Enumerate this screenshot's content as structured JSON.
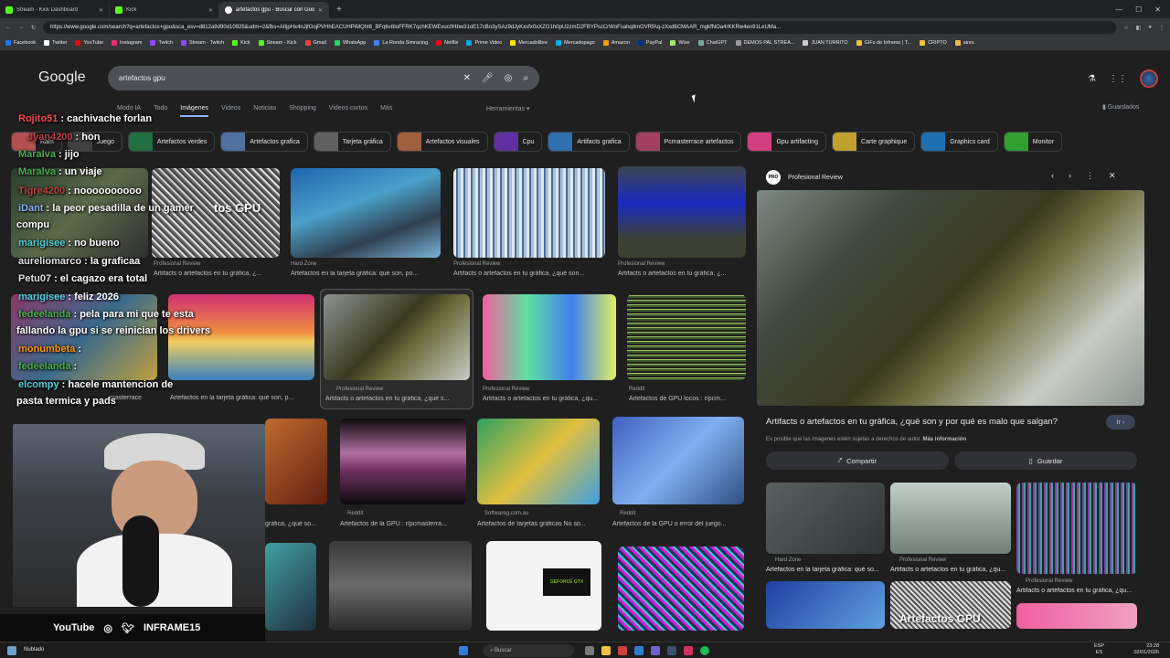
{
  "tabs": [
    {
      "title": "Stream - Kick Dashboard",
      "active": false
    },
    {
      "title": "Kick",
      "active": false
    },
    {
      "title": "artefactos gpu - Buscar con Google",
      "active": true
    }
  ],
  "address": {
    "url": "https://www.google.com/search?q=artefactos+gpu&sca_esv=d812a9d90d10925&udm=2&fbs=AIIjpHx4nJjfGojPVHhEACUHPiMQht6_BFq6v8IoFFRK7qchKEWEvuc0Hbw31oE17cBo3ySAz9dJyKxsfx0xXZG1h0pU2zmD2FBYPszCrWoFsahq8mGVRfAq-zXxd6CMAAR_mgkfNOa4rKKRw4en91LeUMa..."
  },
  "bookmarks": [
    "Facebook",
    "Twitter",
    "YouTube",
    "Instagram",
    "Twitch",
    "Stream - Twitch",
    "Kick",
    "Stream - Kick",
    "Gmail",
    "WhatsApp",
    "La Ronda Simracing",
    "Netflix",
    "Prime Video",
    "Mercadolibre",
    "Mercadopago",
    "Amazon",
    "PayPal",
    "Wise",
    "ChatGPT",
    "DEMOS PAL STREA...",
    "JUAN TURRITO",
    "GIFs de Inframe | T...",
    "CRIPTO",
    "aires"
  ],
  "google": {
    "logo": "Google",
    "query": "artefactos gpu",
    "nav_tabs": [
      "Modo IA",
      "Todo",
      "Imágenes",
      "Videos",
      "Noticias",
      "Shopping",
      "Videos cortos",
      "Más"
    ],
    "active_tab": "Imágenes",
    "tools": "Herramientas",
    "saved": "Guardados",
    "chips": [
      "Ram",
      "Juego",
      "Artefactos verdes",
      "Artefactos grafica",
      "Tarjeta gráfica",
      "Artefactos visuales",
      "Cpu",
      "Artifacts grafica",
      "Pcmasterrace artefactos",
      "Gpu artifacting",
      "Carte graphique",
      "Graphics card",
      "Monitor"
    ]
  },
  "results": [
    {
      "source": "Profesional Review",
      "caption": "Artifacts o artefactos en tu gráfica, ¿..."
    },
    {
      "source": "Hard Zone",
      "caption": "Artefactos en la tarjeta gráfica: qué son, po..."
    },
    {
      "source": "Profesional Review",
      "caption": "Artifacts o artefactos en tu gráfica, ¿qué son..."
    },
    {
      "source": "Profesional Review",
      "caption": "Artifacts o artefactos en tu gráfica, ¿..."
    },
    {
      "source": "",
      "caption": "Artefactos en la tarjeta gráfica: qué son, p..."
    },
    {
      "source": "Profesional Review",
      "caption": "Artifacts o artefactos en tu gráfica, ¿qué s..."
    },
    {
      "source": "Profesional Review",
      "caption": "Artifacts o artefactos en tu gráfica, ¿qu..."
    },
    {
      "source": "Reddit",
      "caption": "Artefactos de GPU locos : r/pcm..."
    },
    {
      "source": "Reddit",
      "caption": "Artefactos de la GPU : r/pcmasterra..."
    },
    {
      "source": "Softwareg.com.au",
      "caption": "Artefactos de tarjetas gráficas No so..."
    },
    {
      "source": "Reddit",
      "caption": "Artefactos de la GPU o error del juego..."
    }
  ],
  "misc_captions": {
    "left_partial": "masterrace",
    "mid_partial": "gráfica, ¿qué so...",
    "overlay_text": "tos GPU",
    "geforce": "GEFORCE GTX"
  },
  "panel": {
    "source": "Profesional Review",
    "source_logo": "PRO",
    "title": "Artifacts o artefactos en tu gráfica, ¿qué son y por qué es malo que salgan?",
    "visit": "Ir",
    "copyright_prefix": "Es posible que las imágenes estén sujetas a derechos de autor.",
    "copyright_link": "Más información",
    "share": "Compartir",
    "save": "Guardar",
    "related": [
      {
        "source": "Hard Zone",
        "caption": "Artefactos en la tarjeta gráfica: qué so..."
      },
      {
        "source": "Profesional Review",
        "caption": "Artifacts o artefactos en tu gráfica, ¿qu..."
      },
      {
        "source": "Profesional Review",
        "caption": "Artifacts o artefactos en tu gráfica, ¿qu..."
      }
    ],
    "bottom_text": "Artefactos GPU"
  },
  "chat": [
    {
      "user": "Rojito51",
      "msg": ": cachivache forlan",
      "color": "#ff4b4b"
    },
    {
      "user": "Jyan4200",
      "msg": ": hon",
      "color": "#c04040"
    },
    {
      "user": "Maralva",
      "msg": ": jijo",
      "color": "#4caf50"
    },
    {
      "user": "Maralva",
      "msg": ": un viaje",
      "color": "#4caf50"
    },
    {
      "user": "Tigre4200",
      "msg": ": noooooooooo",
      "color": "#c04040"
    },
    {
      "user": "iDant",
      "msg": ": la peor pesadilla de un gamer",
      "color": "#8ab4f8"
    },
    {
      "user": "",
      "msg": "compu",
      "color": "#fff"
    },
    {
      "user": "marigisee",
      "msg": ": no bueno",
      "color": "#4dd0e1"
    },
    {
      "user": "aureliomarco",
      "msg": ": la graficaa",
      "color": "#e0e0e0"
    },
    {
      "user": "Petu07",
      "msg": ": el cagazo era total",
      "color": "#e0e0e0"
    },
    {
      "user": "marigisee",
      "msg": ": feliz 2026",
      "color": "#4dd0e1"
    },
    {
      "user": "fedeelanda",
      "msg": ": pela para mi que te esta",
      "color": "#4caf50"
    },
    {
      "user": "",
      "msg": "fallando la gpu si se reinician los drivers",
      "color": "#fff"
    },
    {
      "user": "monumbeta",
      "msg": ":",
      "color": "#ff9800"
    },
    {
      "user": "fedeelanda",
      "msg": ":",
      "color": "#4caf50"
    },
    {
      "user": "elcompy",
      "msg": ": hacele mantencion de",
      "color": "#4dd0e1"
    },
    {
      "user": "",
      "msg": "pasta termica y pads",
      "color": "#fff"
    }
  ],
  "social": {
    "youtube": "YouTube",
    "handle": "INFRAME15"
  },
  "taskbar": {
    "search": "Buscar",
    "weather": "Nublado",
    "lang1": "ESP",
    "lang2": "ES",
    "time": "23:28",
    "date": "02/01/2026"
  }
}
